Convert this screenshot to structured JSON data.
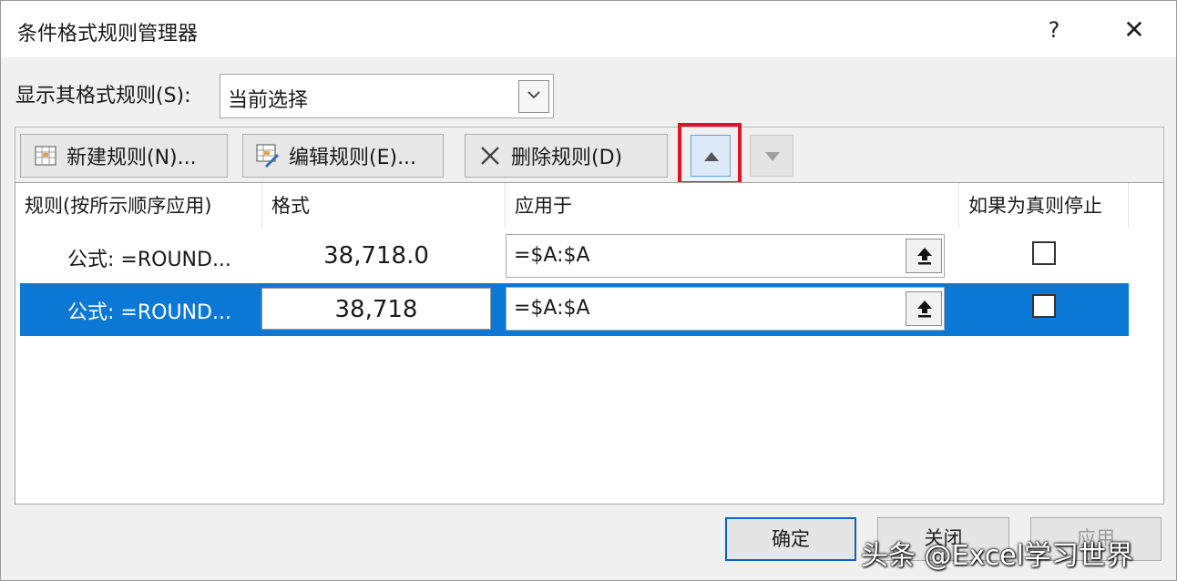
{
  "window": {
    "title": "条件格式规则管理器",
    "help_label": "?",
    "close_label": "✕"
  },
  "show_rules": {
    "label": "显示其格式规则(S):",
    "selected": "当前选择"
  },
  "toolbar": {
    "new_rule": "新建规则(N)...",
    "edit_rule": "编辑规则(E)...",
    "delete_rule": "删除规则(D)"
  },
  "table": {
    "headers": {
      "rule": "规则(按所示顺序应用)",
      "format": "格式",
      "applies_to": "应用于",
      "stop_if_true": "如果为真则停止"
    },
    "rows": [
      {
        "rule": "公式: =ROUND...",
        "format": "38,718.0",
        "applies_to": "=$A:$A",
        "stop_if_true": false,
        "selected": false
      },
      {
        "rule": "公式: =ROUND...",
        "format": "38,718",
        "applies_to": "=$A:$A",
        "stop_if_true": false,
        "selected": true
      }
    ]
  },
  "footer": {
    "ok": "确定",
    "close": "关闭",
    "apply": "应用"
  },
  "watermark": "头条 @Excel学习世界",
  "colors": {
    "selection": "#0a78d4",
    "highlight": "#e0141e"
  }
}
